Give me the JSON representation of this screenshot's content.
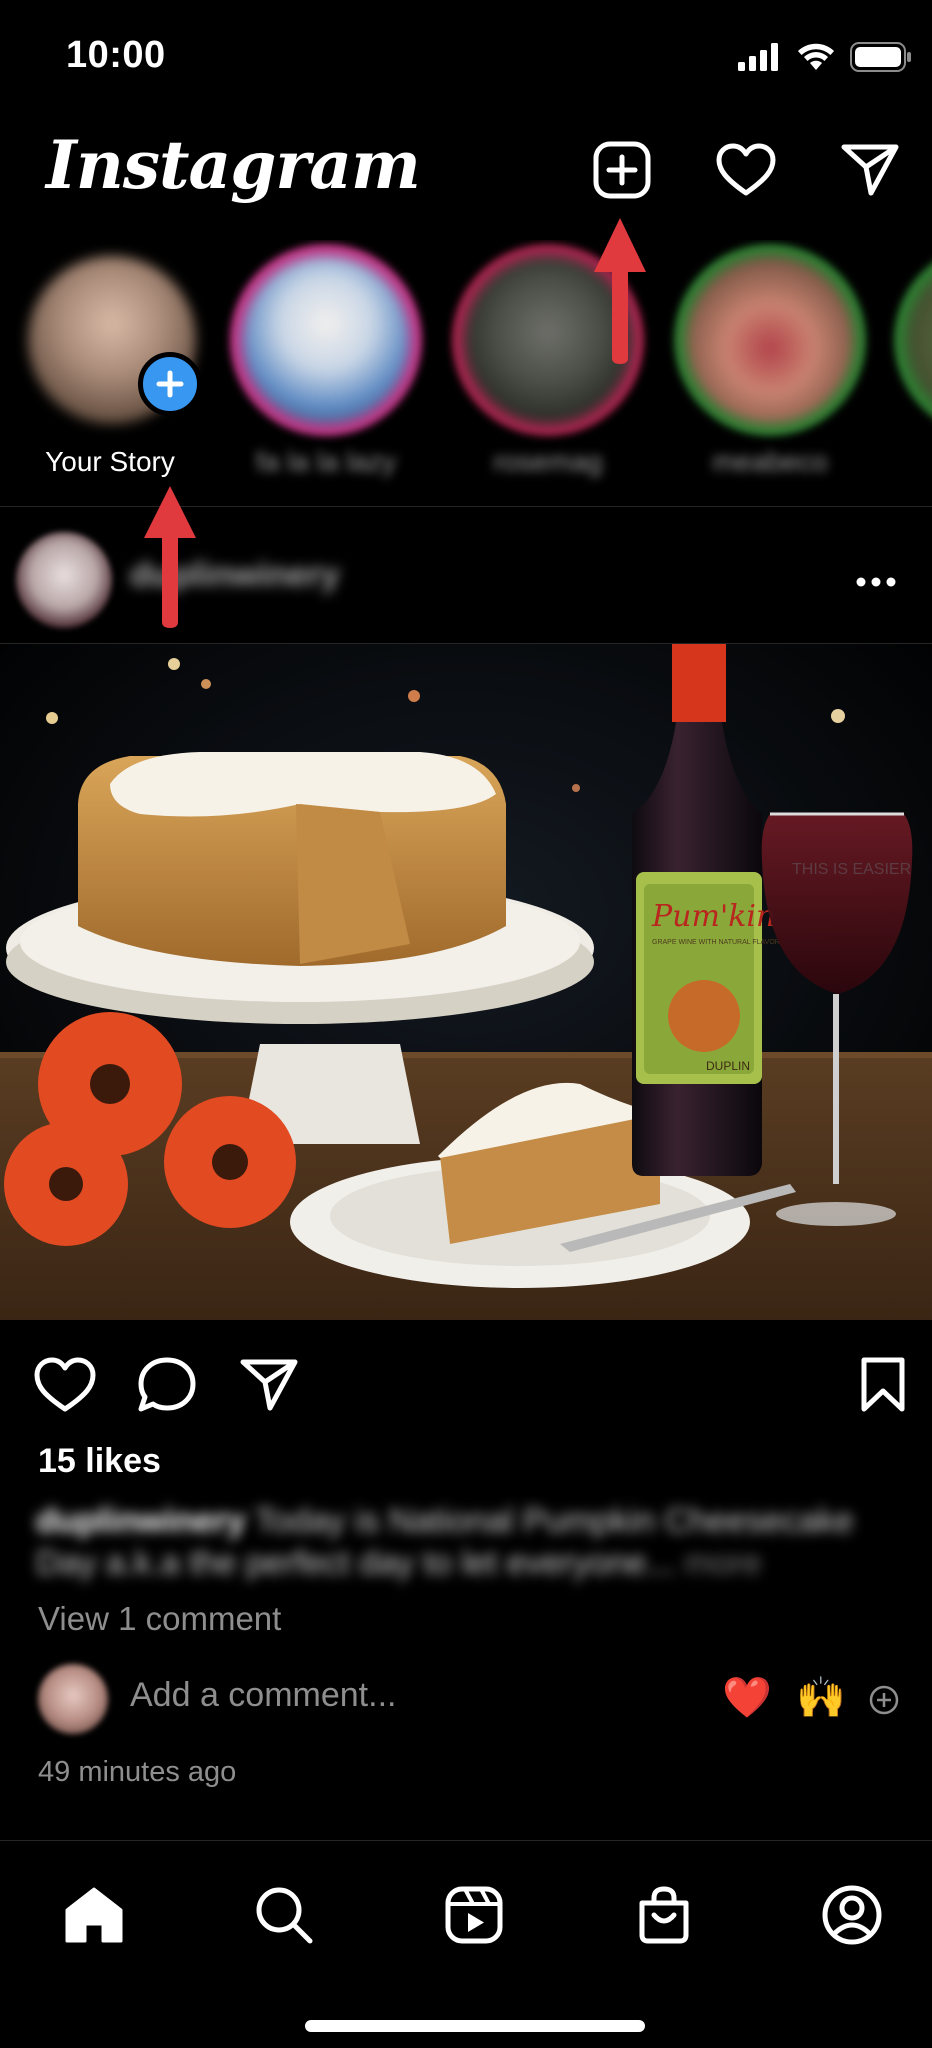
{
  "status_bar": {
    "time": "10:00"
  },
  "header": {
    "logo": "Instagram",
    "icons": [
      "new-post-icon",
      "heart-icon",
      "direct-message-icon"
    ]
  },
  "stories": {
    "own": {
      "label": "Your Story"
    },
    "items": [
      {
        "label": "fa la la lazy",
        "ring_color": "#c13584"
      },
      {
        "label": "rosemag",
        "ring_color": "#c13584"
      },
      {
        "label": "meabeco",
        "ring_color": "#2e7d32"
      }
    ]
  },
  "post": {
    "username": "duplinwinery",
    "likes": "15 likes",
    "caption": {
      "username": "duplinwinery",
      "text": "Today is National Pumpkin Cheesecake Day a.k.a the perfect day to let everyone...",
      "more": "more"
    },
    "view_comments": "View 1 comment",
    "comment_placeholder": "Add a comment...",
    "quick_emojis": [
      "❤️",
      "🙌"
    ],
    "timestamp": "49 minutes ago",
    "image": {
      "bottle_label": "Pum'kin",
      "bottle_subtitle": "GRAPE WINE WITH NATURAL FLAVOR",
      "bottle_brand": "DUPLIN",
      "glass_text": "THIS IS EASIER"
    }
  },
  "tab_bar": {
    "tabs": [
      "home-icon",
      "search-icon",
      "reels-icon",
      "shop-icon",
      "profile-icon"
    ]
  },
  "colors": {
    "background": "#000000",
    "accent_blue": "#3897f0",
    "annotation_red": "#e0393e",
    "secondary_text": "#8e8e8e"
  }
}
